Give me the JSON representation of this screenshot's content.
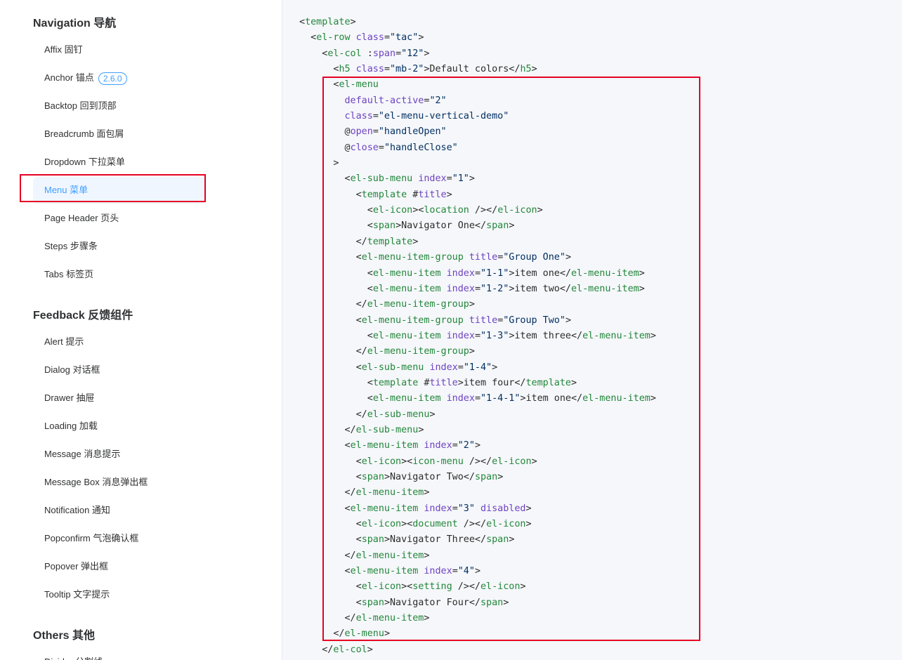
{
  "sidebar": {
    "sections": [
      {
        "title": "Navigation 导航",
        "items": [
          {
            "label": "Affix 固钉"
          },
          {
            "label": "Anchor 锚点",
            "badge": "2.6.0"
          },
          {
            "label": "Backtop 回到顶部"
          },
          {
            "label": "Breadcrumb 面包屑"
          },
          {
            "label": "Dropdown 下拉菜单"
          },
          {
            "label": "Menu 菜单",
            "active": true
          },
          {
            "label": "Page Header 页头"
          },
          {
            "label": "Steps 步骤条"
          },
          {
            "label": "Tabs 标签页"
          }
        ]
      },
      {
        "title": "Feedback 反馈组件",
        "items": [
          {
            "label": "Alert 提示"
          },
          {
            "label": "Dialog 对话框"
          },
          {
            "label": "Drawer 抽屉"
          },
          {
            "label": "Loading 加载"
          },
          {
            "label": "Message 消息提示"
          },
          {
            "label": "Message Box 消息弹出框"
          },
          {
            "label": "Notification 通知"
          },
          {
            "label": "Popconfirm 气泡确认框"
          },
          {
            "label": "Popover 弹出框"
          },
          {
            "label": "Tooltip 文字提示"
          }
        ]
      },
      {
        "title": "Others 其他",
        "items": [
          {
            "label": "Divider 分割线"
          }
        ]
      }
    ]
  },
  "colors": {
    "accent": "#409eff",
    "highlight_border": "#e60023",
    "active_bg": "#f0f6ff",
    "code_bg": "#f5f7fa"
  },
  "code": {
    "lines": [
      "<template>",
      "  <el-row class=\"tac\">",
      "    <el-col :span=\"12\">",
      "      <h5 class=\"mb-2\">Default colors</h5>",
      "      <el-menu",
      "        default-active=\"2\"",
      "        class=\"el-menu-vertical-demo\"",
      "        @open=\"handleOpen\"",
      "        @close=\"handleClose\"",
      "      >",
      "        <el-sub-menu index=\"1\">",
      "          <template #title>",
      "            <el-icon><location /></el-icon>",
      "            <span>Navigator One</span>",
      "          </template>",
      "          <el-menu-item-group title=\"Group One\">",
      "            <el-menu-item index=\"1-1\">item one</el-menu-item>",
      "            <el-menu-item index=\"1-2\">item two</el-menu-item>",
      "          </el-menu-item-group>",
      "          <el-menu-item-group title=\"Group Two\">",
      "            <el-menu-item index=\"1-3\">item three</el-menu-item>",
      "          </el-menu-item-group>",
      "          <el-sub-menu index=\"1-4\">",
      "            <template #title>item four</template>",
      "            <el-menu-item index=\"1-4-1\">item one</el-menu-item>",
      "          </el-sub-menu>",
      "        </el-sub-menu>",
      "        <el-menu-item index=\"2\">",
      "          <el-icon><icon-menu /></el-icon>",
      "          <span>Navigator Two</span>",
      "        </el-menu-item>",
      "        <el-menu-item index=\"3\" disabled>",
      "          <el-icon><document /></el-icon>",
      "          <span>Navigator Three</span>",
      "        </el-menu-item>",
      "        <el-menu-item index=\"4\">",
      "          <el-icon><setting /></el-icon>",
      "          <span>Navigator Four</span>",
      "        </el-menu-item>",
      "      </el-menu>",
      "    </el-col>"
    ]
  }
}
